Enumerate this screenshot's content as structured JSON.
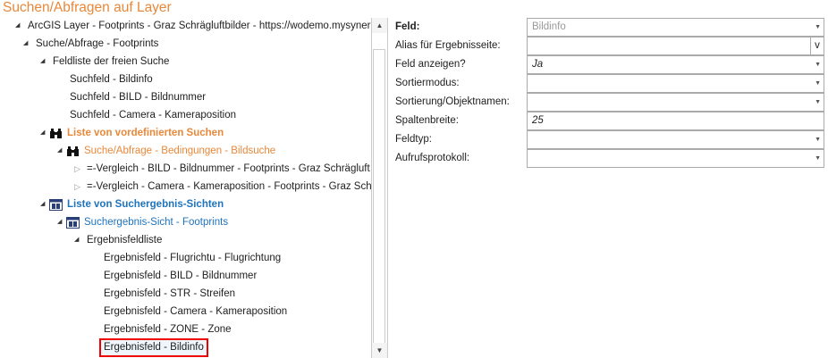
{
  "title": "Suchen/Abfragen auf Layer",
  "tree": {
    "root": "ArcGIS Layer - Footprints - Graz Schrägluftbilder - https://wodemo.mysynergis",
    "search": "Suche/Abfrage - Footprints",
    "free_list": "Feldliste der freien Suche",
    "free_fields": [
      "Suchfeld - Bildinfo",
      "Suchfeld - BILD - Bildnummer",
      "Suchfeld - Camera - Kameraposition"
    ],
    "predefined": "Liste von vordefinierten Suchen",
    "predefined_item": "Suche/Abfrage - Bedingungen - Bildsuche",
    "conditions": [
      "=-Vergleich - BILD - Bildnummer - Footprints - Graz Schrägluft",
      "=-Vergleich - Camera - Kameraposition - Footprints - Graz Sch"
    ],
    "views": "Liste von Suchergebnis-Sichten",
    "view_item": "Suchergebnis-Sicht - Footprints",
    "result_list": "Ergebnisfeldliste",
    "result_fields": [
      "Ergebnisfeld - Flugrichtu - Flugrichtung",
      "Ergebnisfeld - BILD - Bildnummer",
      "Ergebnisfeld - STR - Streifen",
      "Ergebnisfeld - Camera - Kameraposition",
      "Ergebnisfeld - ZONE - Zone",
      "Ergebnisfeld - Bildinfo"
    ]
  },
  "props": [
    {
      "label": "Feld:",
      "value": "Bildinfo"
    },
    {
      "label": "Alias für Ergebnisseite:",
      "value": "",
      "button": "v"
    },
    {
      "label": "Feld anzeigen?",
      "value": "Ja"
    },
    {
      "label": "Sortiermodus:",
      "value": ""
    },
    {
      "label": "Sortierung/Objektnamen:",
      "value": ""
    },
    {
      "label": "Spaltenbreite:",
      "value": "25"
    },
    {
      "label": "Feldtyp:",
      "value": ""
    },
    {
      "label": "Aufrufsprotokoll:",
      "value": ""
    }
  ]
}
